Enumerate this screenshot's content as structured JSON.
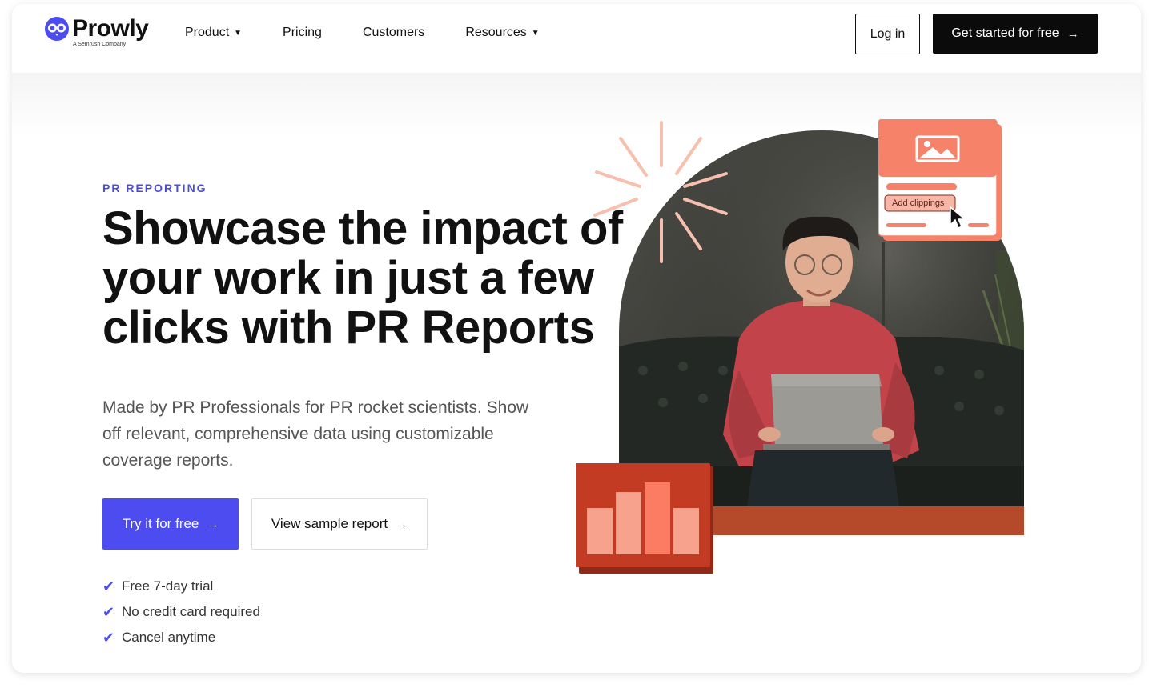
{
  "nav": {
    "logo_text": "Prowly",
    "logo_sub": "A Semrush Company",
    "items": [
      {
        "label": "Product",
        "has_caret": true
      },
      {
        "label": "Pricing",
        "has_caret": false
      },
      {
        "label": "Customers",
        "has_caret": false
      },
      {
        "label": "Resources",
        "has_caret": true
      }
    ],
    "login_label": "Log in",
    "cta_label": "Get started for free"
  },
  "hero": {
    "eyebrow": "PR REPORTING",
    "headline": "Showcase the impact of your work in just a few clicks with PR Reports",
    "lead": "Made by PR Professionals for PR rocket scientists. Show off relevant, comprehensive data using customizable coverage reports.",
    "try_label": "Try it for free",
    "sample_label": "View sample report",
    "checks": [
      "Free 7-day trial",
      "No credit card required",
      "Cancel anytime"
    ]
  },
  "illustration": {
    "clip_label": "Add clippings"
  },
  "colors": {
    "accent": "#4c4cf0",
    "dark": "#0b0b0b",
    "coral": "#f7826a",
    "brick": "#c23b22"
  },
  "icons": {
    "logo": "owl-logo-icon",
    "caret": "caret-down-icon",
    "arrow": "arrow-right-icon",
    "check": "check-icon",
    "image": "image-icon",
    "cursor": "cursor-arrow-icon"
  }
}
